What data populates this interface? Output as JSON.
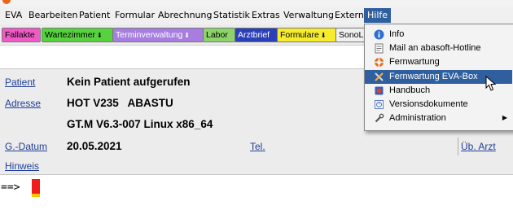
{
  "menu": [
    {
      "label": "EVA"
    },
    {
      "label": "Bearbeiten"
    },
    {
      "label": "Patient"
    },
    {
      "label": "Formular"
    },
    {
      "label": "Abrechnung"
    },
    {
      "label": "Statistik"
    },
    {
      "label": "Extras"
    },
    {
      "label": "Verwaltung"
    },
    {
      "label": "Extern"
    },
    {
      "label": "Hilfe"
    }
  ],
  "toolbar": [
    {
      "label": "Fallakte",
      "bg": "#f05ac6"
    },
    {
      "label": "Wartezimmer",
      "arrow": "⬇",
      "bg": "#56d23c"
    },
    {
      "label": "Terminverwaltung",
      "arrow": "⬇",
      "bg": "#a77ee0"
    },
    {
      "label": "Labor",
      "bg": "#8cd46a"
    },
    {
      "label": "Arztbrief",
      "bg": "#2b3fb8",
      "color": "#ffffff"
    },
    {
      "label": "Formulare",
      "arrow": "⬇",
      "bg": "#f7ec2c"
    },
    {
      "label": "SonoL",
      "bg": "#f0f0f0"
    }
  ],
  "patient": {
    "patient_label": "Patient",
    "patient_value": "Kein Patient aufgerufen",
    "adresse_label": "Adresse",
    "adresse_value1": "HOT V235   ABASTU",
    "adresse_value2": "GT.M V6.3-007 Linux x86_64",
    "gdatum_label": "G.-Datum",
    "gdatum_value": "20.05.2021",
    "tel_label": "Tel.",
    "ueb_arzt_label": "Üb. Arzt",
    "hinweis_label": "Hinweis"
  },
  "cmd": {
    "prompt": "==>"
  },
  "help_menu": [
    {
      "label": "Info",
      "icon": "info-icon"
    },
    {
      "label": "Mail an abasoft-Hotline",
      "icon": "mail-icon"
    },
    {
      "label": "Fernwartung",
      "icon": "lifebuoy-icon"
    },
    {
      "label": "Fernwartung EVA-Box",
      "icon": "tools-icon",
      "highlighted": true
    },
    {
      "label": "Handbuch",
      "icon": "book-icon"
    },
    {
      "label": "Versionsdokumente",
      "icon": "documents-icon"
    },
    {
      "label": "Administration",
      "icon": "wrench-icon",
      "submenu": true
    }
  ]
}
